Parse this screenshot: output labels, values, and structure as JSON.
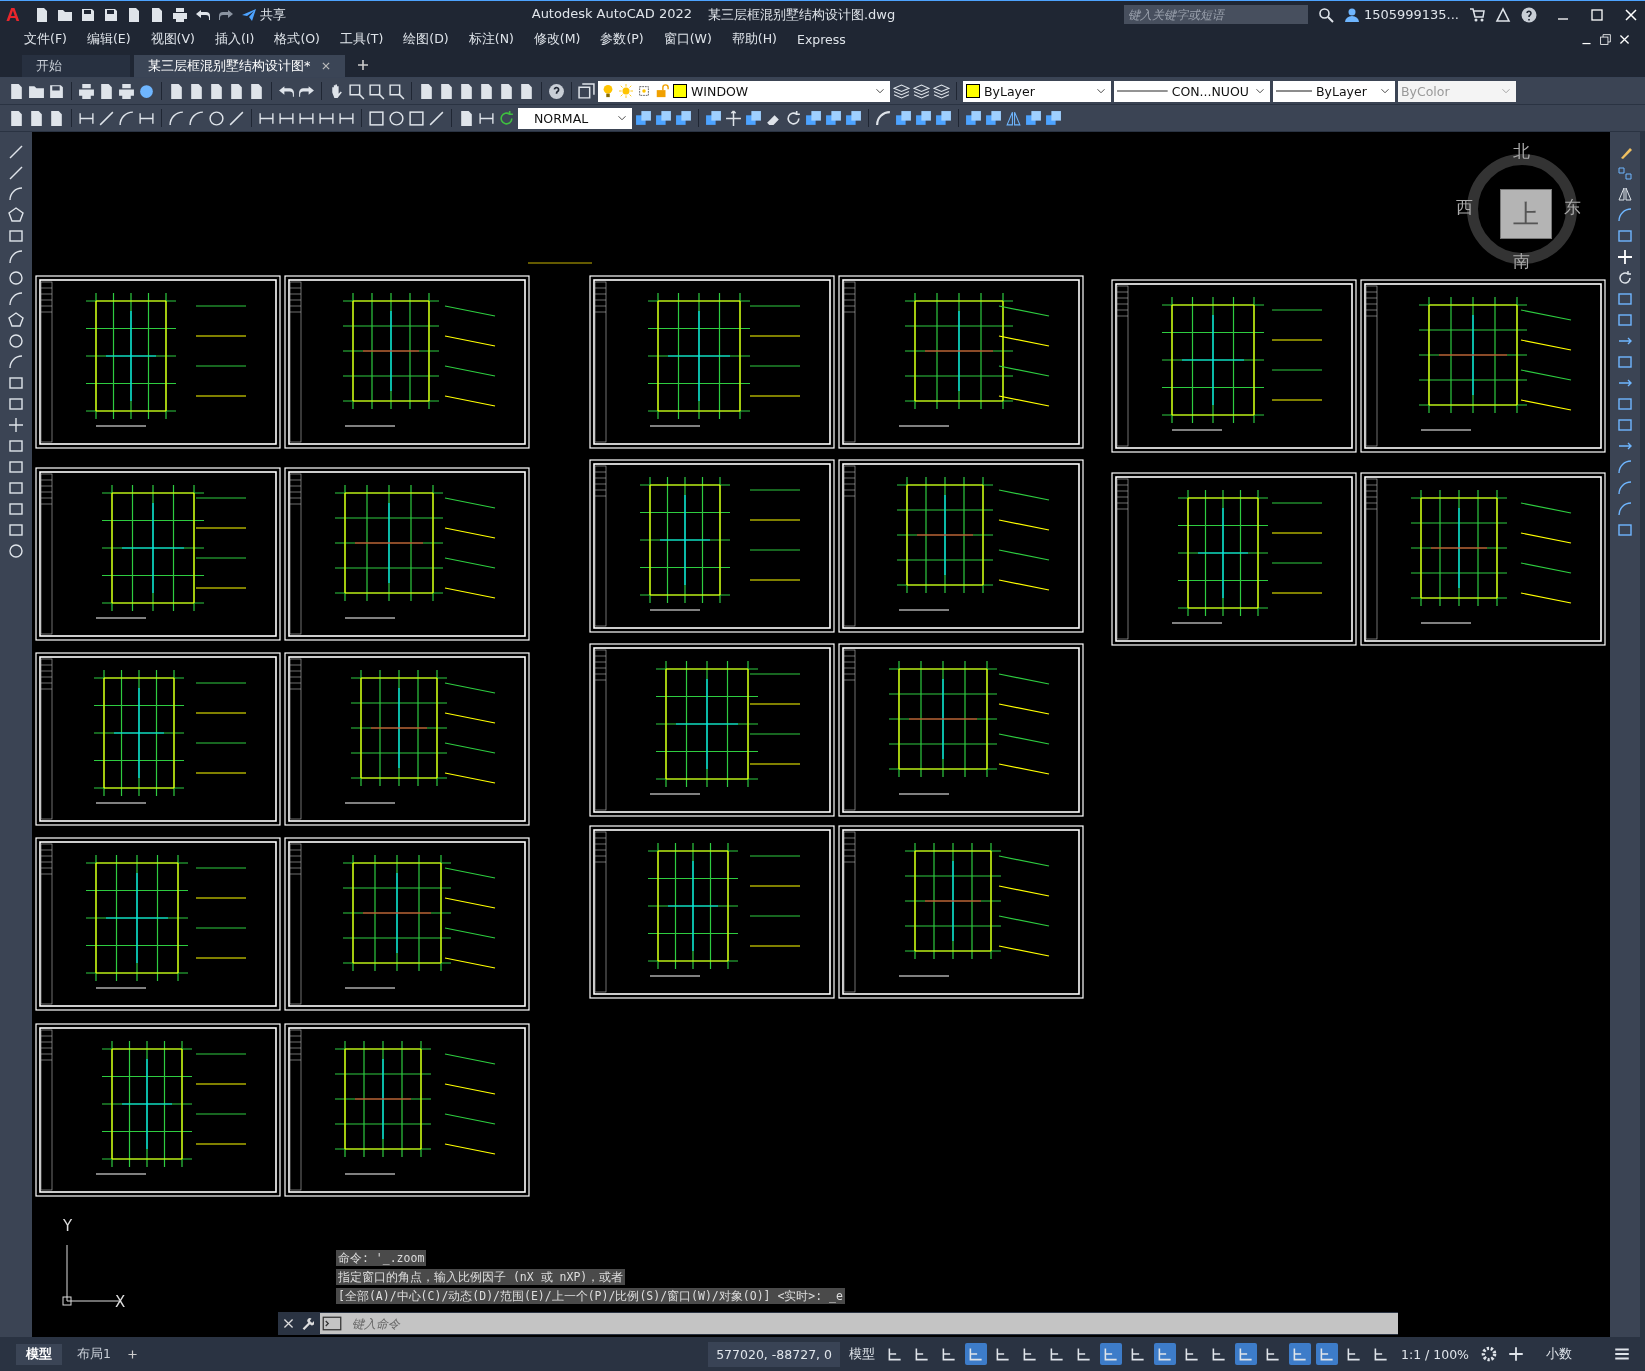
{
  "title_bar": {
    "logo": "A",
    "share": "共享",
    "app": "Autodesk AutoCAD 2022",
    "document": "某三层框混别墅结构设计图.dwg",
    "search": {
      "placeholder": "键入关键字或短语"
    },
    "user": "1505999135..."
  },
  "menu": [
    "文件(F)",
    "编辑(E)",
    "视图(V)",
    "插入(I)",
    "格式(O)",
    "工具(T)",
    "绘图(D)",
    "标注(N)",
    "修改(M)",
    "参数(P)",
    "窗口(W)",
    "帮助(H)",
    "Express"
  ],
  "tabs": [
    {
      "label": "开始",
      "selected": false
    },
    {
      "label": "某三层框混别墅结构设计图*",
      "selected": true
    }
  ],
  "properties": {
    "layer": "WINDOW",
    "color_setting": "ByLayer",
    "linetype": "CON...NUOU",
    "lineweight": "ByLayer",
    "plot_style": {
      "value": "ByColor",
      "disabled": true
    },
    "dim_style": "NORMAL"
  },
  "viewcube": {
    "north": "北",
    "west": "西",
    "east": "东",
    "south": "南",
    "face": "上"
  },
  "ucs": {
    "y": "Y",
    "x": "X"
  },
  "command_history": [
    "命令: '_.zoom",
    "指定窗口的角点，输入比例因子 (nX 或 nXP)，或者",
    "[全部(A)/中心(C)/动态(D)/范围(E)/上一个(P)/比例(S)/窗口(W)/对象(O)] <实时>: _e"
  ],
  "command_input": {
    "placeholder": "键入命令"
  },
  "layout_tabs": [
    {
      "label": "模型",
      "selected": true
    },
    {
      "label": "布局1",
      "selected": false
    }
  ],
  "status_bar": {
    "coordinates": "577020, -88727, 0",
    "space": "模型",
    "scale": "1:1 / 100%",
    "units": "小数",
    "toggles": [
      {
        "on": false
      },
      {
        "on": false
      },
      {
        "on": false
      },
      {
        "on": true
      },
      {
        "on": false
      },
      {
        "on": false
      },
      {
        "on": false
      },
      {
        "on": false
      },
      {
        "on": true
      },
      {
        "on": false
      },
      {
        "on": true
      },
      {
        "on": false
      },
      {
        "on": false
      },
      {
        "on": true
      },
      {
        "on": false
      },
      {
        "on": true
      },
      {
        "on": true
      },
      {
        "on": false
      },
      {
        "on": false
      }
    ]
  }
}
